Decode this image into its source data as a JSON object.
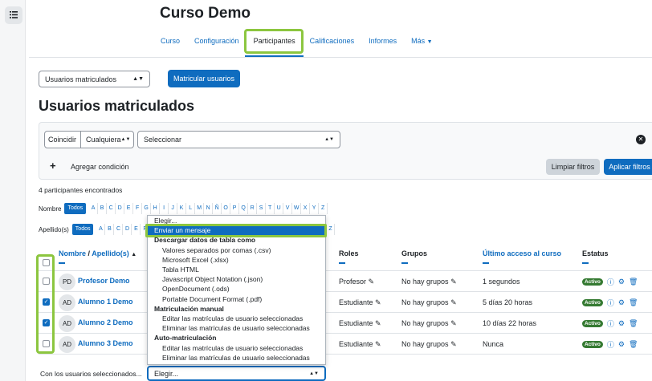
{
  "course": {
    "title": "Curso Demo",
    "tabs": [
      "Curso",
      "Configuración",
      "Participantes",
      "Calificaciones",
      "Informes",
      "Más"
    ]
  },
  "enrol": {
    "method_select": "Usuarios matriculados",
    "enrol_button": "Matricular usuarios"
  },
  "heading": "Usuarios matriculados",
  "filter": {
    "match_label": "Coincidir",
    "match_value": "Cualquiera",
    "select_value": "Seleccionar",
    "add_condition": "Agregar condición",
    "clear_button": "Limpiar filtros",
    "apply_button": "Aplicar filtros"
  },
  "count_text": "4 participantes encontrados",
  "alpha": {
    "first_label": "Nombre",
    "last_label": "Apellido(s)",
    "all_label": "Todos",
    "letters": [
      "A",
      "B",
      "C",
      "D",
      "E",
      "F",
      "G",
      "H",
      "I",
      "J",
      "K",
      "L",
      "M",
      "N",
      "Ñ",
      "O",
      "P",
      "Q",
      "R",
      "S",
      "T",
      "U",
      "V",
      "W",
      "X",
      "Y",
      "Z"
    ]
  },
  "table": {
    "headers": {
      "name": "Nombre",
      "sep": "/",
      "surname": "Apellido(s)",
      "roles": "Roles",
      "groups": "Grupos",
      "last_access": "Último acceso al curso",
      "status": "Estatus"
    },
    "rows": [
      {
        "initials": "PD",
        "name": "Profesor Demo",
        "role": "Profesor",
        "groups": "No hay grupos",
        "access": "1 segundos",
        "status": "Activo",
        "checked": false
      },
      {
        "initials": "AD",
        "name": "Alumno 1 Demo",
        "role": "Estudiante",
        "groups": "No hay grupos",
        "access": "5 días 20 horas",
        "status": "Activo",
        "checked": true
      },
      {
        "initials": "AD",
        "name": "Alumno 2 Demo",
        "role": "Estudiante",
        "groups": "No hay grupos",
        "access": "10 días 22 horas",
        "status": "Activo",
        "checked": true
      },
      {
        "initials": "AD",
        "name": "Alumno 3 Demo",
        "role": "Estudiante",
        "groups": "No hay grupos",
        "access": "Nunca",
        "status": "Activo",
        "checked": false
      }
    ]
  },
  "bulk": {
    "label": "Con los usuarios seleccionados...",
    "select_value": "Elegir..."
  },
  "dropdown": {
    "items": [
      {
        "text": "Elegir...",
        "kind": "item"
      },
      {
        "text": "Enviar un mensaje",
        "kind": "selected"
      },
      {
        "text": "Descargar datos de tabla como",
        "kind": "group"
      },
      {
        "text": "Valores separados por comas (.csv)",
        "kind": "sub"
      },
      {
        "text": "Microsoft Excel (.xlsx)",
        "kind": "sub"
      },
      {
        "text": "Tabla HTML",
        "kind": "sub"
      },
      {
        "text": "Javascript Object Notation (.json)",
        "kind": "sub"
      },
      {
        "text": "OpenDocument (.ods)",
        "kind": "sub"
      },
      {
        "text": "Portable Document Format (.pdf)",
        "kind": "sub"
      },
      {
        "text": "Matriculación manual",
        "kind": "group"
      },
      {
        "text": "Editar las matrículas de usuario seleccionadas",
        "kind": "sub"
      },
      {
        "text": "Eliminar las matrículas de usuario seleccionadas",
        "kind": "sub"
      },
      {
        "text": "Auto-matriculación",
        "kind": "group"
      },
      {
        "text": "Editar las matrículas de usuario seleccionadas",
        "kind": "sub"
      },
      {
        "text": "Eliminar las matrículas de usuario seleccionadas",
        "kind": "sub"
      }
    ]
  },
  "colors": {
    "primary": "#0f6cbf",
    "highlight": "#8cc63f",
    "active_badge": "#357a32"
  }
}
